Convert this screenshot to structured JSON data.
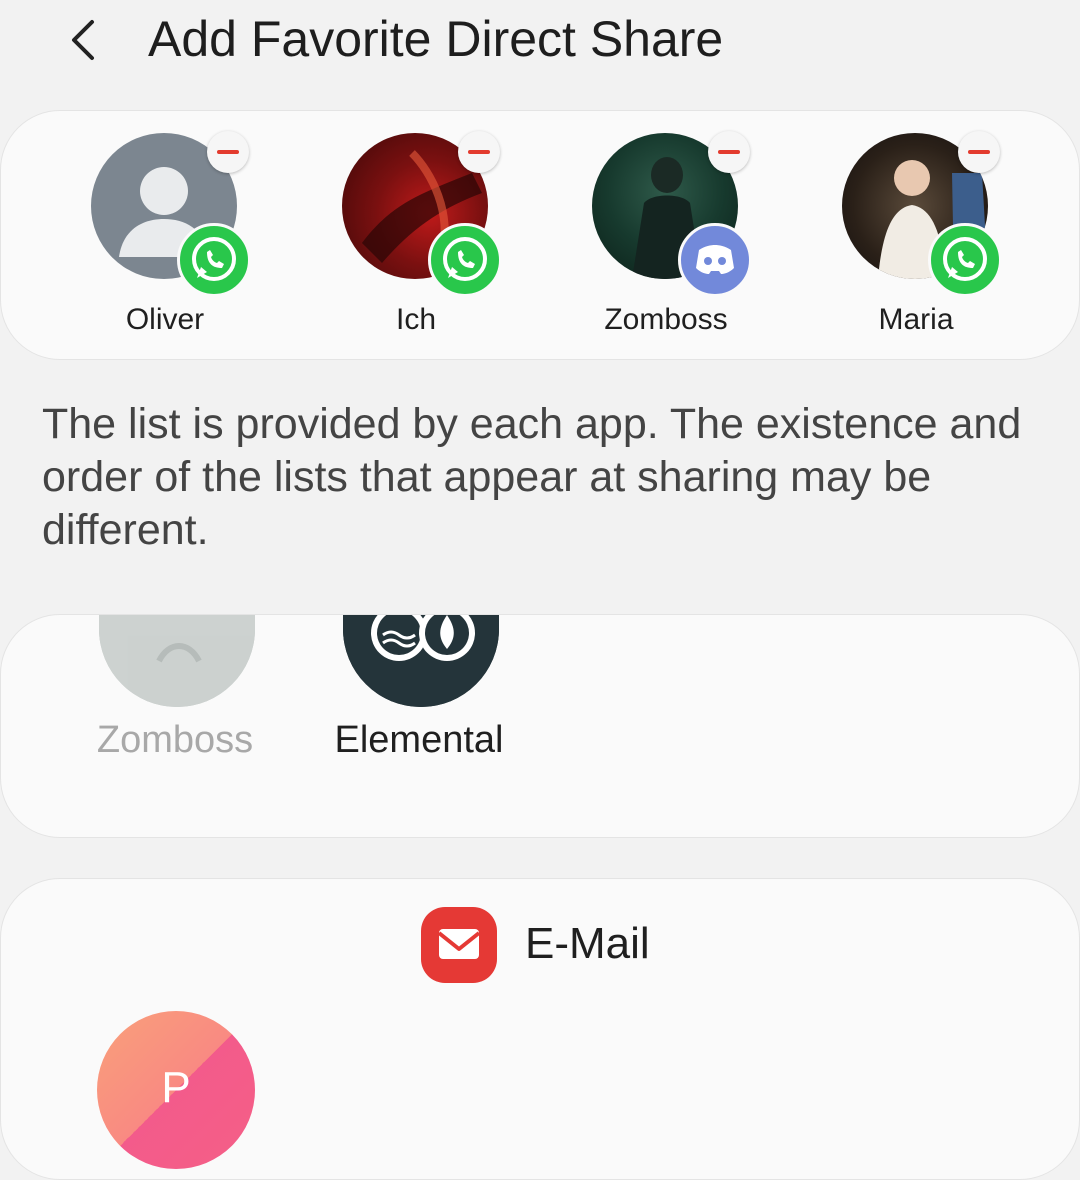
{
  "header": {
    "title": "Add Favorite Direct Share",
    "back_icon": "chevron-left-icon"
  },
  "favorites": [
    {
      "name": "Oliver",
      "app": "whatsapp",
      "app_icon": "whatsapp-icon",
      "avatar": "default-person"
    },
    {
      "name": "Ich",
      "app": "whatsapp",
      "app_icon": "whatsapp-icon",
      "avatar": "photo-red"
    },
    {
      "name": "Zomboss",
      "app": "discord",
      "app_icon": "discord-icon",
      "avatar": "photo-dark-green"
    },
    {
      "name": "Maria",
      "app": "whatsapp",
      "app_icon": "whatsapp-icon",
      "avatar": "photo-wedding"
    }
  ],
  "info_text": "The list is provided by each app. The existence and order of the lists that appear at sharing may be different.",
  "app_section": {
    "items": [
      {
        "name": "Zomboss",
        "state": "disabled"
      },
      {
        "name": "Elemental",
        "state": "enabled"
      }
    ]
  },
  "email_section": {
    "label": "E-Mail",
    "icon": "mail-icon",
    "contact_initial": "P"
  },
  "colors": {
    "remove": "#e33b2e",
    "whatsapp": "#29c74b",
    "discord": "#7289da",
    "email_icon": "#e53935",
    "background": "#f2f2f2",
    "card": "#fafafa"
  }
}
